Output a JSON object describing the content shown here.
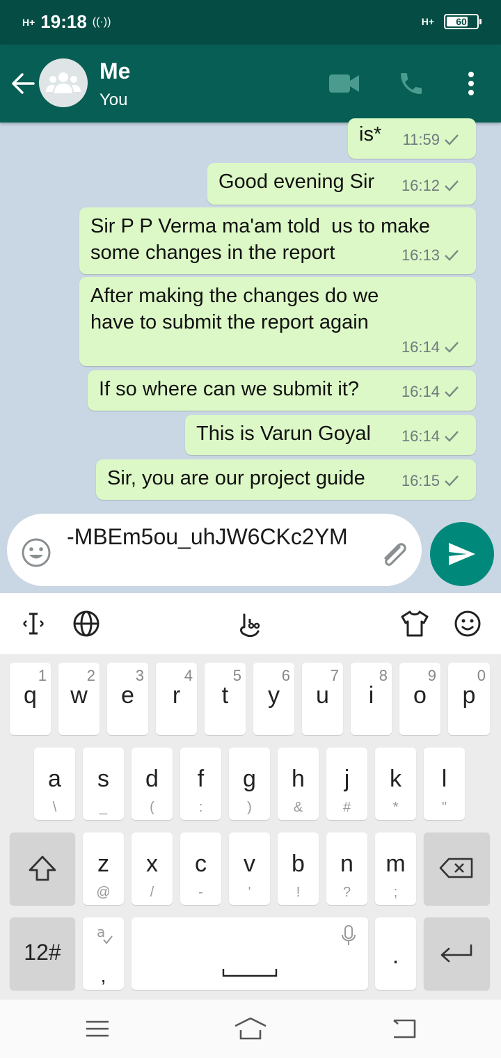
{
  "status_bar": {
    "time": "19:18",
    "network_left": "H+",
    "network_right": "H+",
    "battery": "60"
  },
  "header": {
    "contact_name": "Me",
    "contact_subtitle": "You"
  },
  "messages": [
    {
      "text": "is*",
      "time": "11:59"
    },
    {
      "text": "Good evening Sir",
      "time": "16:12"
    },
    {
      "text": "Sir P P Verma ma'am told  us to make\nsome changes in the report",
      "time": "16:13"
    },
    {
      "text": "After making the changes do we\nhave to submit the report again",
      "time": "16:14"
    },
    {
      "text": "If so where can we submit it?",
      "time": "16:14"
    },
    {
      "text": "This is Varun Goyal",
      "time": "16:14"
    },
    {
      "text": "Sir, you are our project guide",
      "time": "16:15"
    }
  ],
  "composer": {
    "value": "-MBEm5ou_uhJW6CKc2YM"
  },
  "keyboard": {
    "row1": [
      {
        "key": "q",
        "hint": "1"
      },
      {
        "key": "w",
        "hint": "2"
      },
      {
        "key": "e",
        "hint": "3"
      },
      {
        "key": "r",
        "hint": "4"
      },
      {
        "key": "t",
        "hint": "5"
      },
      {
        "key": "y",
        "hint": "6"
      },
      {
        "key": "u",
        "hint": "7"
      },
      {
        "key": "i",
        "hint": "8"
      },
      {
        "key": "o",
        "hint": "9"
      },
      {
        "key": "p",
        "hint": "0"
      }
    ],
    "row2": [
      {
        "key": "a",
        "sub": "\\"
      },
      {
        "key": "s",
        "sub": "_"
      },
      {
        "key": "d",
        "sub": "("
      },
      {
        "key": "f",
        "sub": ":"
      },
      {
        "key": "g",
        "sub": ")"
      },
      {
        "key": "h",
        "sub": "&"
      },
      {
        "key": "j",
        "sub": "#"
      },
      {
        "key": "k",
        "sub": "*"
      },
      {
        "key": "l",
        "sub": "\""
      }
    ],
    "row3": [
      {
        "key": "z",
        "sub": "@"
      },
      {
        "key": "x",
        "sub": "/"
      },
      {
        "key": "c",
        "sub": "-"
      },
      {
        "key": "v",
        "sub": "'"
      },
      {
        "key": "b",
        "sub": "!"
      },
      {
        "key": "n",
        "sub": "?"
      },
      {
        "key": "m",
        "sub": ";"
      }
    ],
    "numbers_key": "12#",
    "comma_key": ",",
    "period_key": "."
  },
  "colors": {
    "status_bar": "#054d44",
    "header": "#075e54",
    "outgoing_bubble": "#dcf8c6",
    "send_button": "#00897b",
    "chat_background": "#c9d6e3"
  },
  "icons": {
    "back": "arrow-left-icon",
    "avatar": "group-icon",
    "video": "video-call-icon",
    "call": "phone-icon",
    "menu": "more-vert-icon",
    "emoji": "emoji-icon",
    "attach": "paperclip-icon",
    "send": "send-icon"
  }
}
